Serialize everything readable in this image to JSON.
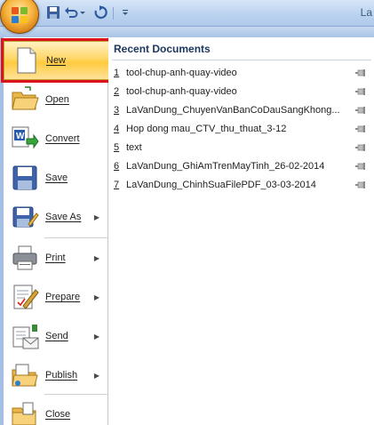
{
  "titlebar": {
    "title_fragment": "La",
    "office_button": "office-orb",
    "quick_access": [
      "save-icon",
      "undo-icon",
      "undo-dropdown-icon",
      "redo-icon",
      "customize-icon"
    ]
  },
  "menu": {
    "items": [
      {
        "label": "New",
        "icon": "new-document-icon",
        "has_submenu": false,
        "highlighted": true
      },
      {
        "label": "Open",
        "icon": "open-folder-icon",
        "has_submenu": false
      },
      {
        "label": "Convert",
        "icon": "convert-icon",
        "has_submenu": false
      },
      {
        "label": "Save",
        "icon": "save-disk-icon",
        "has_submenu": false
      },
      {
        "label": "Save As",
        "icon": "save-as-icon",
        "has_submenu": true
      },
      {
        "label": "Print",
        "icon": "printer-icon",
        "has_submenu": true
      },
      {
        "label": "Prepare",
        "icon": "prepare-icon",
        "has_submenu": true
      },
      {
        "label": "Send",
        "icon": "send-icon",
        "has_submenu": true
      },
      {
        "label": "Publish",
        "icon": "publish-icon",
        "has_submenu": true
      },
      {
        "label": "Close",
        "icon": "close-folder-icon",
        "has_submenu": false
      }
    ],
    "submenu_arrow": "▶"
  },
  "recent": {
    "title": "Recent Documents",
    "items": [
      {
        "num": "1",
        "name": "tool-chup-anh-quay-video"
      },
      {
        "num": "2",
        "name": "tool-chup-anh-quay-video"
      },
      {
        "num": "3",
        "name": "LaVanDung_ChuyenVanBanCoDauSangKhong..."
      },
      {
        "num": "4",
        "name": "Hop dong mau_CTV_thu_thuat_3-12"
      },
      {
        "num": "5",
        "name": "text"
      },
      {
        "num": "6",
        "name": "LaVanDung_GhiAmTrenMayTinh_26-02-2014"
      },
      {
        "num": "7",
        "name": "LaVanDung_ChinhSuaFilePDF_03-03-2014"
      }
    ]
  },
  "colors": {
    "highlight": "#ffd767",
    "highlight_border": "#d9141b",
    "recent_title": "#1c3760",
    "frame": "#a4bfe3"
  }
}
